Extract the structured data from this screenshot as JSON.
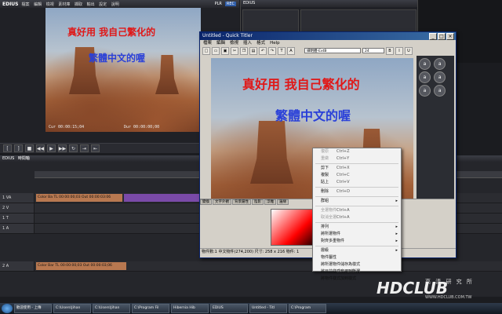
{
  "preview": {
    "app_name": "EDIUS",
    "menu": [
      "檔案",
      "編輯",
      "檢視",
      "素材庫",
      "擷取",
      "輸出",
      "設定",
      "說明"
    ],
    "mode_labels": [
      "PLR",
      "REC"
    ],
    "overlay_line1": "真好用 我自己繁化的",
    "overlay_line2": "繁體中文的喔",
    "timecode_left": "Cur 00:00:15;04",
    "timecode_right": "Dur 00:00:00;00"
  },
  "bin": {
    "app_name": "EDIUS"
  },
  "timeline": {
    "label": "EDIUS",
    "panel_label": "時間軸",
    "tracks": [
      {
        "name": "1 VA",
        "clip": "Color Ba  TL 00:00:00;03 Out 00:00:03:06"
      },
      {
        "name": "2 V",
        "clip": ""
      },
      {
        "name": "1 T",
        "clip": ""
      },
      {
        "name": "1 A",
        "clip": ""
      },
      {
        "name": "2 A",
        "clip": "Color Bar  TL 00:00:00;03 Out 00:00:03;06"
      }
    ]
  },
  "dialog": {
    "title": "Untitled - Quick Titler",
    "menu": [
      "檔案",
      "編輯",
      "檢視",
      "插入",
      "格式",
      "Help"
    ],
    "font_value": "細明體-ExtB",
    "size_value": "24",
    "canvas_line1": "真好用 我自己繁化的",
    "canvas_line2": "繁體中文的喔",
    "tabs": [
      "變換",
      "文字外觀",
      "背景屬性",
      "陰影",
      "浮雕",
      "邊緣"
    ],
    "status": "物件數:1 中文物件(274,200) 尺寸: 258 x 216 物件: 1"
  },
  "context_menu": {
    "items": [
      {
        "label": "復原",
        "shortcut": "Ctrl+Z",
        "disabled": true
      },
      {
        "label": "重做",
        "shortcut": "Ctrl+Y",
        "disabled": true
      },
      {
        "sep": true
      },
      {
        "label": "剪下",
        "shortcut": "Ctrl+X"
      },
      {
        "label": "複製",
        "shortcut": "Ctrl+C"
      },
      {
        "label": "貼上",
        "shortcut": "Ctrl+V"
      },
      {
        "sep": true
      },
      {
        "label": "刪除",
        "shortcut": "Ctrl+D"
      },
      {
        "sep": true
      },
      {
        "label": "群組",
        "shortcut": "",
        "submenu": true
      },
      {
        "sep": true
      },
      {
        "label": "全選物件",
        "shortcut": "Ctrl+A",
        "disabled": true
      },
      {
        "label": "取消全選",
        "shortcut": "Ctrl+A",
        "disabled": true
      },
      {
        "sep": true
      },
      {
        "label": "排列",
        "shortcut": "",
        "submenu": true
      },
      {
        "label": "將所選物件",
        "shortcut": "",
        "submenu": true
      },
      {
        "label": "對齊多重物件",
        "shortcut": "",
        "submenu": true
      },
      {
        "sep": true
      },
      {
        "label": "層級",
        "shortcut": "",
        "submenu": true
      },
      {
        "label": "物件屬性",
        "shortcut": ""
      },
      {
        "label": "將所選物件儲存為樣式",
        "shortcut": ""
      },
      {
        "label": "將目前樣式套用到所選",
        "shortcut": "Ctrl+Shift+I"
      },
      {
        "label": "將物件樣式加到樣式",
        "shortcut": ""
      }
    ]
  },
  "taskbar": {
    "tasks": [
      "歡迎使用 - 上傳",
      "C:\\Users\\Jihan",
      "C:\\Users\\Jihan",
      "C:\\Program Fil",
      "Hibernia Hib",
      "EDIUS",
      "Untitled - Titl",
      "C:\\Program"
    ]
  },
  "branding": {
    "logo_text": "HDCLUB",
    "logo_sub": "高 清 研 究 所",
    "url": "WWW.HDCLUB.COM.TW"
  }
}
